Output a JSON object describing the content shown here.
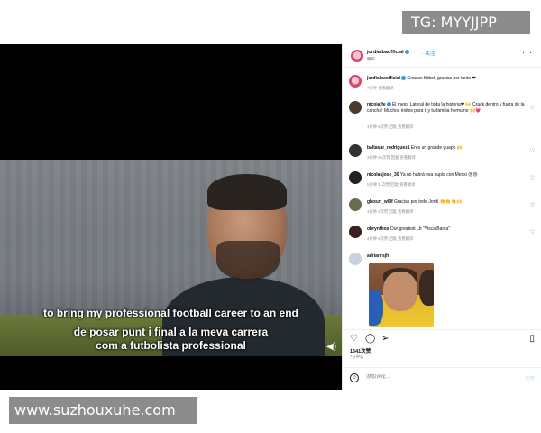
{
  "watermark_top": "TG: MYYJJPP",
  "watermark_bottom": "www.suzhouxuhe.com",
  "video": {
    "subtitle_en": "to bring my professional football career to an end",
    "subtitle_ca_1": "de posar punt i final a la meva carrera",
    "subtitle_ca_2": "com a futbolista professional",
    "sound_icon": "◀)"
  },
  "post": {
    "header": {
      "username": "jordialbaofficial",
      "follow_label": "· 关注",
      "subtitle": "原声"
    },
    "more_icon": "···",
    "caption": {
      "username": "jordialbaofficial",
      "text": "Gracias fútbol, gracias por tanto ❤",
      "meta": "7分钟    查看翻译"
    },
    "comments": [
      {
        "username": "nicojaffe",
        "text": "El mejor Lateral de toda la historia❤ 🙌 Crack dentro y fuera de la cancha! Muchos éxitos para ti y tu familia hermano 🙌💗",
        "meta": "3分钟    6次赞    回复    查看翻译",
        "avatar_color": "#4a3b2a"
      },
      {
        "username": "baltasar_rodriguez1",
        "text": "Eres un grande guapo 🙌",
        "meta": "3分钟    20次赞    回复    查看翻译",
        "avatar_color": "#333333"
      },
      {
        "username": "nicolasjose_30",
        "text": "Ya no habrá esa dupla con Messi 😢😢",
        "meta": "5分钟    11次赞    回复    查看翻译",
        "avatar_color": "#222222"
      },
      {
        "username": "ghoszt_w0lf",
        "text": "Gracias por todo Jordi 👏👏👏🙌",
        "meta": "3分钟    2次赞    回复    查看翻译",
        "avatar_color": "#6a6a50"
      },
      {
        "username": "obrynthos",
        "text": "Our greatest Lb \"Visca Barca\"",
        "meta": "3分钟    4次赞    回复    查看翻译",
        "avatar_color": "#3a1f22"
      },
      {
        "username": "adrianrsjh",
        "text": "",
        "meta": "",
        "avatar_color": "#c9d3de"
      }
    ],
    "likes": "1641次赞",
    "date": "7分钟前",
    "add_comment_placeholder": "添加评论...",
    "post_label": "发布",
    "icons": {
      "like": "heart-icon",
      "comment": "comment-icon",
      "share": "share-icon",
      "save": "bookmark-icon",
      "emoji": "emoji-icon"
    }
  }
}
